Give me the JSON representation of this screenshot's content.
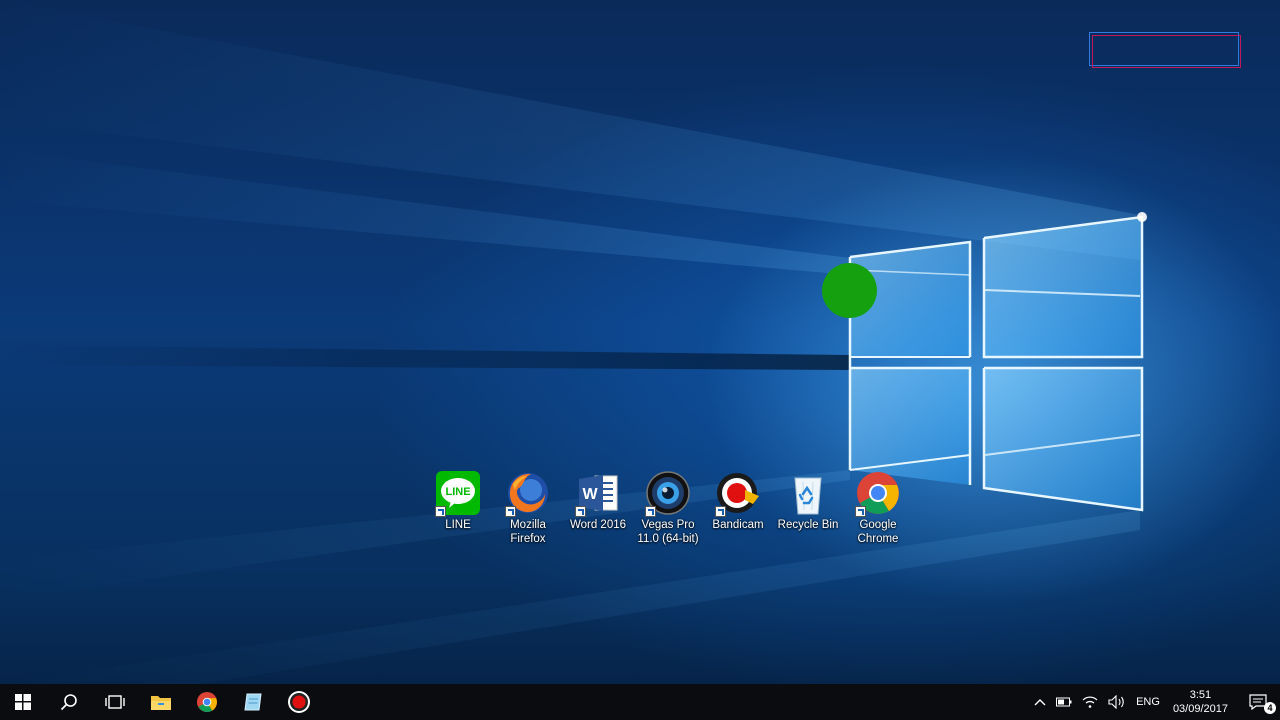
{
  "desktop": {
    "icons": [
      {
        "id": "line",
        "label": "LINE",
        "icon": "line-app-icon"
      },
      {
        "id": "firefox",
        "label": "Mozilla\nFirefox",
        "icon": "firefox-icon"
      },
      {
        "id": "word",
        "label": "Word 2016",
        "icon": "word-icon"
      },
      {
        "id": "vegas",
        "label": "Vegas Pro\n11.0 (64-bit)",
        "icon": "vegas-pro-icon"
      },
      {
        "id": "bandicam",
        "label": "Bandicam",
        "icon": "bandicam-icon"
      },
      {
        "id": "recycle",
        "label": "Recycle Bin",
        "icon": "recycle-bin-icon"
      },
      {
        "id": "chrome",
        "label": "Google\nChrome",
        "icon": "chrome-icon"
      }
    ],
    "line_text": "LINE",
    "word_letter": "W"
  },
  "taskbar": {
    "pinned": [
      "start-icon",
      "search-icon",
      "task-view-icon",
      "file-explorer-icon",
      "chrome-icon",
      "notepad-icon",
      "record-icon"
    ],
    "tray": {
      "language": "ENG",
      "time": "3:51",
      "date": "03/09/2017",
      "notification_count": "4"
    }
  },
  "colors": {
    "taskbar_bg": "#0a0c10",
    "accent": "#1a5fb4",
    "cursor_highlight": "#15a010"
  }
}
